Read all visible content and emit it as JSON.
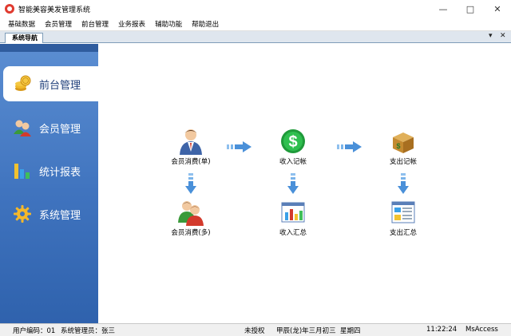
{
  "window": {
    "title": "智能美容美发管理系统"
  },
  "menu": {
    "items": [
      "基础数据",
      "会员管理",
      "前台管理",
      "业务报表",
      "辅助功能",
      "帮助退出"
    ]
  },
  "tab": {
    "label": "系统导航"
  },
  "sidebar": {
    "items": [
      {
        "label": "前台管理",
        "icon": "coins-icon",
        "active": true
      },
      {
        "label": "会员管理",
        "icon": "members-icon",
        "active": false
      },
      {
        "label": "统计报表",
        "icon": "bar-chart-icon",
        "active": false
      },
      {
        "label": "系统管理",
        "icon": "gear-icon",
        "active": false
      }
    ]
  },
  "flow": {
    "member_consume_single": "会员消费(单)",
    "income_record": "收入记帐",
    "expense_record": "支出记帐",
    "member_consume_multi": "会员消费(多)",
    "income_summary": "收入汇总",
    "expense_summary": "支出汇总"
  },
  "status": {
    "user_code": "用户编码：01",
    "admin": "系统管理员：张三",
    "license": "未授权",
    "lunar_date": "甲辰(龙)年三月初三",
    "weekday": "星期四",
    "time": "11:22:24",
    "db": "MsAccess"
  },
  "colors": {
    "sidebar": "#3f73be",
    "accent": "#2f62ad",
    "arrow": "#4a90d9"
  }
}
